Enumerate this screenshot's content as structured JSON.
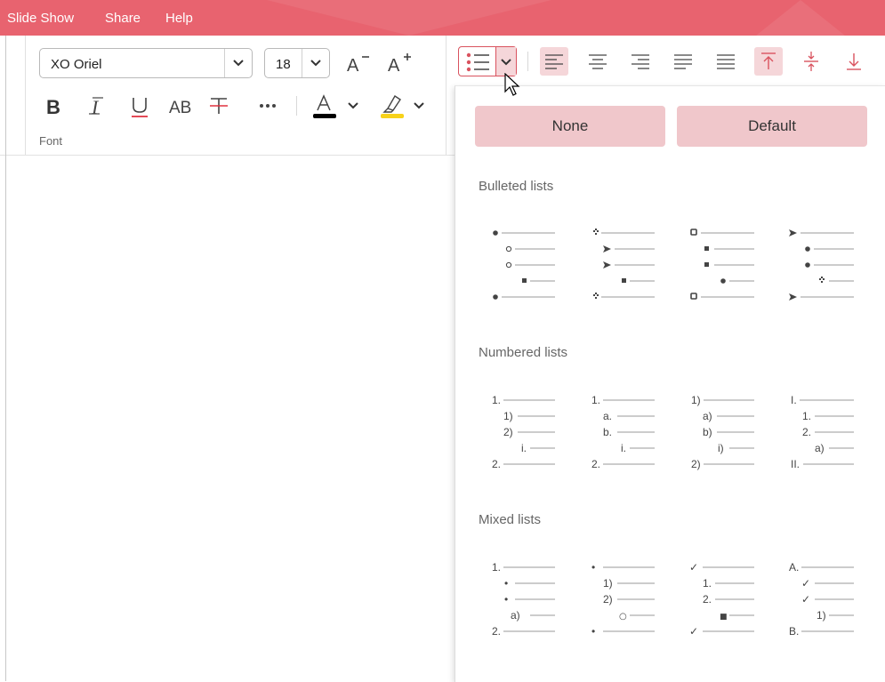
{
  "menubar": {
    "items": [
      "Slide Show",
      "Share",
      "Help"
    ],
    "color": "#e8636f"
  },
  "font_group": {
    "font_name": "XO Oriel",
    "font_size": "18",
    "label": "Font",
    "font_color_bar": "#000000",
    "highlight_color_bar": "#f7d21a"
  },
  "bullets_panel": {
    "none_label": "None",
    "default_label": "Default",
    "bulleted_title": "Bulleted lists",
    "numbered_title": "Numbered lists",
    "mixed_title": "Mixed lists",
    "numbered_presets": [
      [
        "1.",
        "1)",
        "2)",
        "i.",
        "2."
      ],
      [
        "1.",
        "a.",
        "b.",
        "i.",
        "2."
      ],
      [
        "1)",
        "a)",
        "b)",
        "i)",
        "2)"
      ],
      [
        "I.",
        "1.",
        "2.",
        "a)",
        "II."
      ]
    ],
    "mixed_presets": [
      [
        "1.",
        "•",
        "•",
        "a)",
        "2."
      ],
      [
        "•",
        "1)",
        "2)",
        "○",
        "•"
      ],
      [
        "✓",
        "1.",
        "2.",
        "■",
        "✓"
      ],
      [
        "A.",
        "✓",
        "✓",
        "1)",
        "B."
      ]
    ]
  }
}
